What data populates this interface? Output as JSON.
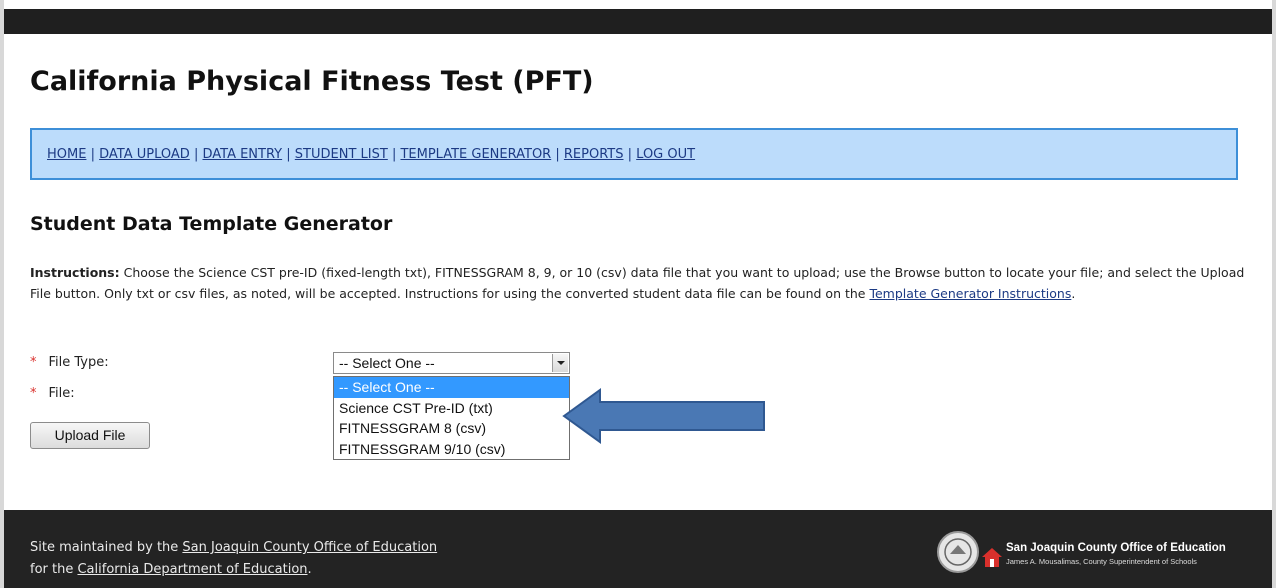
{
  "page": {
    "title": "California Physical Fitness Test (PFT)"
  },
  "nav": {
    "items": [
      "HOME",
      "DATA UPLOAD",
      "DATA ENTRY",
      "STUDENT LIST",
      "TEMPLATE GENERATOR",
      "REPORTS",
      "LOG OUT"
    ],
    "separator": "|"
  },
  "section": {
    "title": "Student Data Template Generator"
  },
  "instructions": {
    "label": "Instructions:",
    "text": " Choose the Science CST pre-ID (fixed-length txt), FITNESSGRAM 8, 9, or 10 (csv) data file that you want to upload; use the Browse button to locate your file; and select the Upload File button. Only txt or csv files, as noted, will be accepted. Instructions for using the converted student data file can be found on the ",
    "link": "Template Generator Instructions",
    "end": "."
  },
  "form": {
    "required_marker": "*",
    "file_type_label": "File Type:",
    "file_label": "File:",
    "select_value": "-- Select One --",
    "options": [
      "-- Select One --",
      "Science CST Pre-ID (txt)",
      "FITNESSGRAM 8 (csv)",
      "FITNESSGRAM 9/10 (csv)"
    ],
    "upload_button": "Upload File"
  },
  "annotation": {
    "arrow_color": "#4a78b4",
    "points_to": "Science CST Pre-ID (txt)"
  },
  "footer": {
    "line1_prefix": "Site maintained by the ",
    "line1_link": "San Joaquin County Office of Education",
    "line2_prefix": "for the ",
    "line2_link": "California Department of Education",
    "line2_end": ".",
    "logo_name": "San Joaquin County Office of Education",
    "logo_sub": "James A. Mousalimas, County Superintendent of Schools"
  },
  "colors": {
    "nav_bg": "#bcdcfb",
    "nav_border": "#3d8fd8",
    "link": "#1c3a84",
    "footer_bg": "#232323",
    "required": "#d9302c",
    "selected_option": "#3399ff"
  }
}
